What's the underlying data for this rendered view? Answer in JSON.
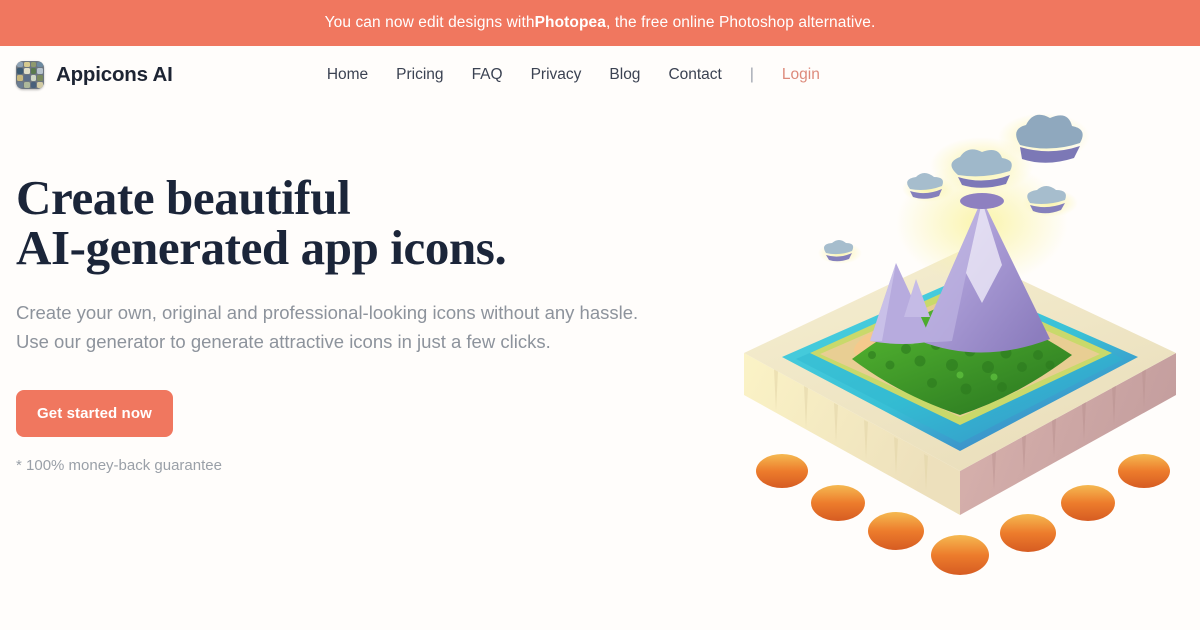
{
  "banner": {
    "text_before": "You can now edit designs with ",
    "brand": "Photopea",
    "text_after": ", the free online Photoshop alternative.",
    "background": "#F0775F",
    "text_color": "#FFFFFF"
  },
  "header": {
    "logo_icon": "app-grid-logo-icon",
    "brand_name": "Appicons AI",
    "nav": [
      {
        "label": "Home"
      },
      {
        "label": "Pricing"
      },
      {
        "label": "FAQ"
      },
      {
        "label": "Privacy"
      },
      {
        "label": "Blog"
      },
      {
        "label": "Contact"
      }
    ],
    "separator": "|",
    "login_label": "Login",
    "login_color": "#DD8A7B"
  },
  "hero": {
    "headline_line1": "Create beautiful",
    "headline_line2": "AI-generated app icons.",
    "headline_color": "#1B2539",
    "subtitle": "Create your own, original and professional-looking icons without any hassle. Use our generator to generate attractive icons in just a few clicks.",
    "subtitle_color": "#8D939C",
    "cta_label": "Get started now",
    "cta_color": "#F0775F",
    "guarantee": "* 100% money-back guarantee",
    "illustration": {
      "name": "3d-island-volcano-illustration",
      "colors": {
        "base_left": "#F7EEB8",
        "base_right": "#CBA8A6",
        "base_top": "#EFE4C2",
        "feet": "#E8732A",
        "water": "#3FC6D8",
        "forest": "#3E9E2B",
        "mountain": "#A99BD6",
        "sand": "#F3C485",
        "cloud": "#8FA8BE",
        "glow": "#F6F0A8"
      }
    }
  },
  "page": {
    "background": "#FFFDFB"
  }
}
